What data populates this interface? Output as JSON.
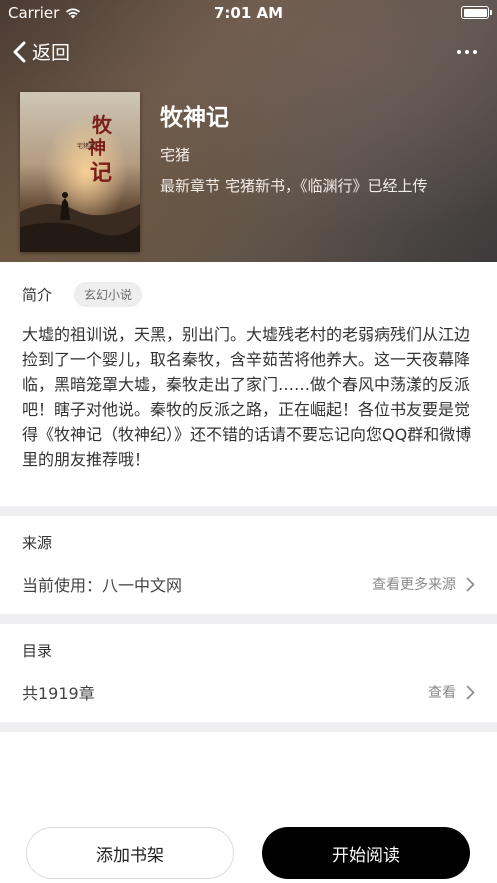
{
  "status_bar": {
    "carrier": "Carrier",
    "time": "7:01 AM"
  },
  "nav": {
    "back_label": "返回"
  },
  "book": {
    "title": "牧神记",
    "author": "宅猪",
    "latest_label": "最新章节",
    "latest_chapter": "宅猪新书，《临渊行》已经上传",
    "cover_title": "牧神记",
    "cover_author": "宅猪著"
  },
  "intro": {
    "label": "简介",
    "genre": "玄幻小说",
    "text": "大墟的祖训说，天黑，别出门。大墟残老村的老弱病残们从江边捡到了一个婴儿，取名秦牧，含辛茹苦将他养大。这一天夜幕降临，黑暗笼罩大墟，秦牧走出了家门……做个春风中荡漾的反派吧！瞎子对他说。秦牧的反派之路，正在崛起！各位书友要是觉得《牧神记（牧神纪）》还不错的话请不要忘记向您QQ群和微博里的朋友推荐哦！"
  },
  "source": {
    "title": "来源",
    "current": "当前使用：八一中文网",
    "more_label": "查看更多来源"
  },
  "catalog": {
    "title": "目录",
    "count": "共1919章",
    "view_label": "查看"
  },
  "actions": {
    "add_shelf": "添加书架",
    "start_read": "开始阅读"
  },
  "colors": {
    "primary_button": "#000000",
    "divider": "#efeff2",
    "tag_bg": "#eeeeef"
  }
}
